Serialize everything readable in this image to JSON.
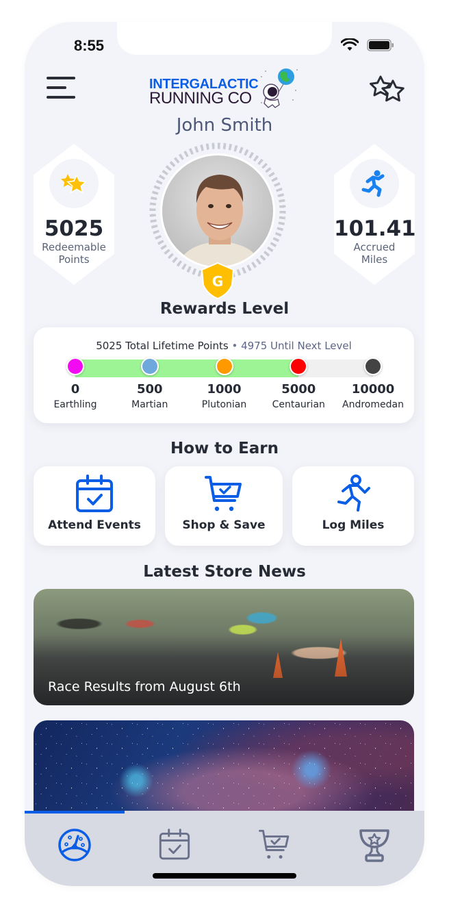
{
  "status_bar": {
    "time": "8:55"
  },
  "header": {
    "logo_line1": "INTERGALACTIC",
    "logo_line2": "RUNNING CO",
    "menu_icon": "hamburger-menu-icon",
    "favorites_icon": "two-stars-outline-icon"
  },
  "profile": {
    "name": "John Smith",
    "tier_badge": "G"
  },
  "stats": {
    "points": {
      "value": "5025",
      "label_line1": "Redeemable",
      "label_line2": "Points",
      "icon": "stars-icon"
    },
    "miles": {
      "value": "101.41",
      "label_line1": "Accrued",
      "label_line2": "Miles",
      "icon": "runner-icon"
    }
  },
  "rewards": {
    "title": "Rewards Level",
    "total_text": "5025 Total Lifetime Points",
    "separator": " • ",
    "remaining_text": "4975 Until Next Level",
    "progress_fraction": 0.75,
    "levels": [
      {
        "points": "0",
        "name": "Earthling",
        "color": "#f20bf2"
      },
      {
        "points": "500",
        "name": "Martian",
        "color": "#6fa8dc"
      },
      {
        "points": "1000",
        "name": "Plutonian",
        "color": "#ff9900"
      },
      {
        "points": "5000",
        "name": "Centaurian",
        "color": "#ff0000"
      },
      {
        "points": "10000",
        "name": "Andromedan",
        "color": "#434343"
      }
    ]
  },
  "earn": {
    "title": "How to Earn",
    "items": [
      {
        "label": "Attend Events",
        "icon": "calendar-check-icon"
      },
      {
        "label": "Shop & Save",
        "icon": "cart-check-icon"
      },
      {
        "label": "Log Miles",
        "icon": "runner-icon"
      }
    ]
  },
  "news": {
    "title": "Latest Store News",
    "items": [
      {
        "title": "Race Results from August 6th"
      }
    ]
  },
  "tabbar": {
    "items": [
      {
        "name": "dashboard",
        "icon": "speedometer-icon",
        "active": true
      },
      {
        "name": "events",
        "icon": "calendar-check-icon",
        "active": false
      },
      {
        "name": "shop",
        "icon": "cart-check-icon",
        "active": false
      },
      {
        "name": "rewards",
        "icon": "trophy-star-icon",
        "active": false
      }
    ]
  },
  "colors": {
    "accent": "#0a5ee6",
    "progress_fill": "#9df495",
    "badge_gold": "#ffbf00",
    "tab_inactive": "#68708a"
  }
}
